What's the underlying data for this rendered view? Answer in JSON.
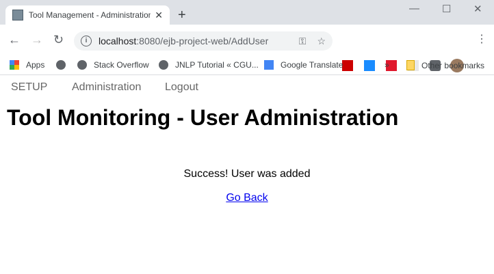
{
  "browser": {
    "tab_title": "Tool Management - Administration",
    "url_host": "localhost",
    "url_rest": ":8080/ejb-project-web/AddUser",
    "bookmarks": [
      "Apps",
      "",
      "Stack Overflow",
      "JNLP Tutorial « CGU...",
      "Google Translate"
    ],
    "overflow": "»",
    "other_bookmarks": "Other bookmarks"
  },
  "menu": {
    "items": [
      "SETUP",
      "Administration",
      "Logout"
    ]
  },
  "page": {
    "title": "Tool Monitoring - User Administration",
    "message": "Success! User was added",
    "back_link": "Go Back"
  }
}
